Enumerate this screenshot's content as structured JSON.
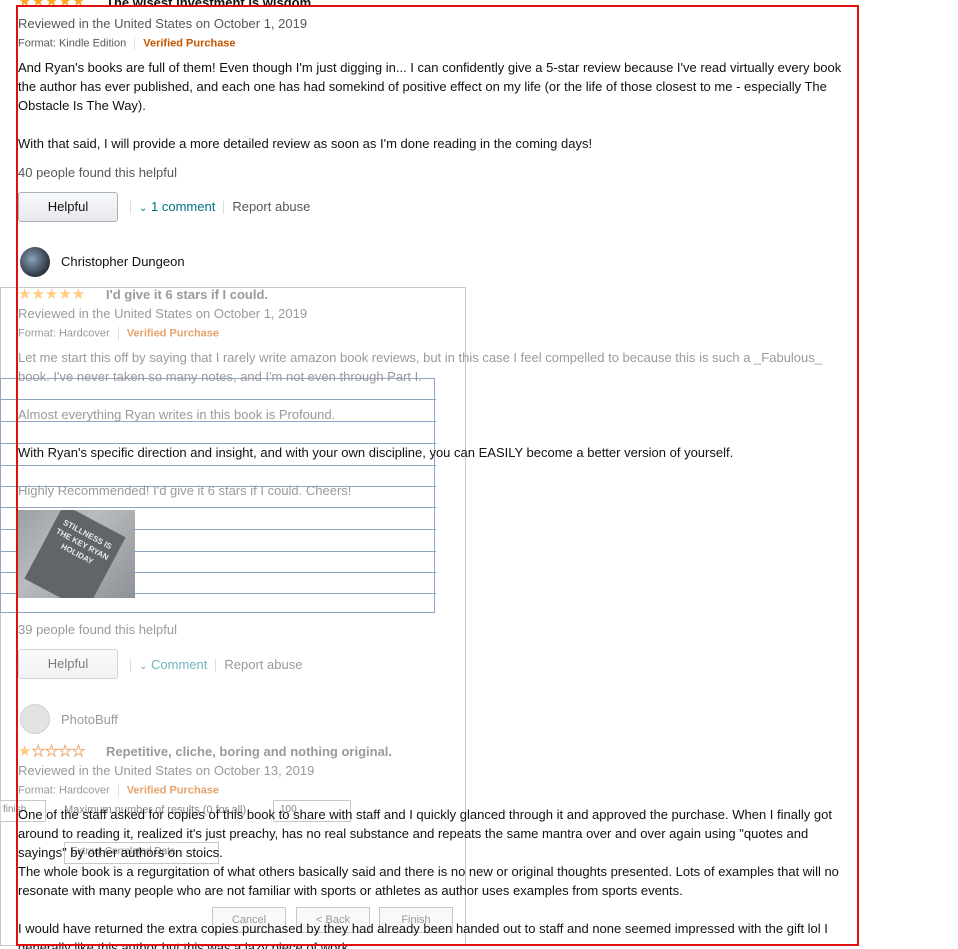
{
  "review1": {
    "title": "The wisest investment is wisdom...",
    "stars": 5,
    "date": "Reviewed in the United States on October 1, 2019",
    "format": "Format: Kindle Edition",
    "verified": "Verified Purchase",
    "body_p1": "And Ryan's books are full of them! Even though I'm just digging in... I can confidently give a 5-star review because I've read virtually every book the author has ever published, and each one has had somekind of positive effect on my life (or the life of those closest to me - especially The Obstacle Is The Way).",
    "body_p2": "With that said, I will provide a more detailed review as soon as I'm done reading in the coming days!",
    "helpful_count": "40 people found this helpful",
    "helpful_label": "Helpful",
    "comment_link": "1 comment",
    "report_label": "Report abuse"
  },
  "review2": {
    "author": "Christopher Dungeon",
    "title": "I'd give it 6 stars if I could.",
    "stars": 5,
    "date": "Reviewed in the United States on October 1, 2019",
    "format": "Format: Hardcover",
    "verified": "Verified Purchase",
    "body_p1": "Let me start this off by saying that I rarely write amazon book reviews, but in this case I feel compelled to because this is such a _Fabulous_ book. I've never taken so many notes, and I'm not even through Part I.",
    "body_p2": "Almost everything Ryan writes in this book is Profound.",
    "body_p3": "With Ryan's specific direction and insight, and with your own discipline, you can EASILY become a better version of yourself.",
    "body_p4": "Highly Recommended! I'd give it 6 stars if I could. Cheers!",
    "image_text": "STILLNESS IS THE KEY RYAN HOLIDAY",
    "helpful_count": "39 people found this helpful",
    "helpful_label": "Helpful",
    "comment_link": "Comment",
    "report_label": "Report abuse"
  },
  "review3": {
    "author": "PhotoBuff",
    "title": "Repetitive, cliche, boring and nothing original.",
    "stars": 1,
    "date": "Reviewed in the United States on October 13, 2019",
    "format": "Format: Hardcover",
    "verified": "Verified Purchase",
    "body_p1": "One of the staff asked for copies of this book to share with staff and I quickly glanced through it and approved the purchase. When I finally got around to reading it, realized it's just preachy, has no real substance and repeats the same mantra over and over again using \"quotes and sayings\" by other authors on stoics.",
    "body_p2": "The whole book is a regurgitation of what others basically said and there is no new or original thoughts presented. Lots of examples that will no resonate with many people who are not familiar with sports or athletes as author uses examples from sports events.",
    "body_p3": "I would have returned the extra copies purchased by they had already been handed out to staff and none seemed impressed with the gift lol I generally like this author but this was a lazy piece of work."
  },
  "wizard": {
    "field_left": "finish",
    "max_label": "Maximum number of results (0 for all)",
    "max_value": "100",
    "extract_label": "Extract Correlated Data",
    "cancel_label": "Cancel",
    "back_label": "< Back",
    "finish_label": "Finish"
  },
  "colors": {
    "highlight_border": "#e01010",
    "star": "#ffa41c",
    "verified": "#c45500",
    "link": "#007185"
  }
}
